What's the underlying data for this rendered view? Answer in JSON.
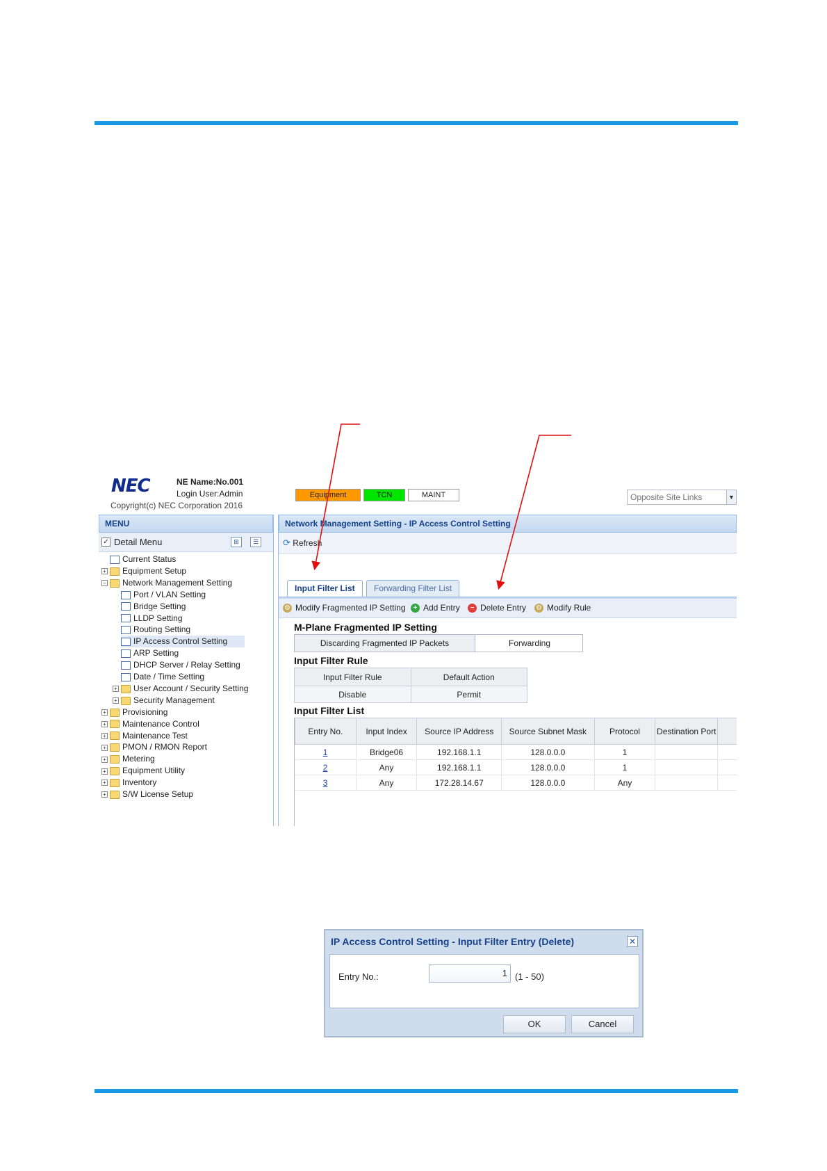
{
  "header": {
    "logo": "NEC",
    "ne_name": "NE Name:No.001",
    "login_user": "Login User:Admin",
    "copyright": "Copyright(c) NEC Corporation 2016",
    "status": [
      {
        "label": "Equipment",
        "color": "#ff9900"
      },
      {
        "label": "TCN",
        "color": "#00e600"
      },
      {
        "label": "MAINT",
        "color": "#ffffff"
      }
    ],
    "opposite_site_links": "Opposite Site Links"
  },
  "menu": {
    "title": "MENU",
    "detail_menu": "Detail Menu",
    "items": [
      {
        "label": "Current Status"
      },
      {
        "label": "Equipment Setup"
      },
      {
        "label": "Network Management Setting"
      },
      {
        "label": "Port / VLAN Setting"
      },
      {
        "label": "Bridge Setting"
      },
      {
        "label": "LLDP Setting"
      },
      {
        "label": "Routing Setting"
      },
      {
        "label": "IP Access Control Setting"
      },
      {
        "label": "ARP Setting"
      },
      {
        "label": "DHCP Server / Relay Setting"
      },
      {
        "label": "Date / Time Setting"
      },
      {
        "label": "User Account / Security Setting"
      },
      {
        "label": "Security Management"
      },
      {
        "label": "Provisioning"
      },
      {
        "label": "Maintenance Control"
      },
      {
        "label": "Maintenance Test"
      },
      {
        "label": "PMON / RMON Report"
      },
      {
        "label": "Metering"
      },
      {
        "label": "Equipment Utility"
      },
      {
        "label": "Inventory"
      },
      {
        "label": "S/W License Setup"
      }
    ]
  },
  "main": {
    "title": "Network Management Setting - IP Access Control Setting",
    "refresh": "Refresh",
    "tabs": [
      {
        "label": "Input Filter List"
      },
      {
        "label": "Forwarding Filter List"
      }
    ],
    "actions": [
      {
        "label": "Modify Fragmented IP Setting"
      },
      {
        "label": "Add Entry"
      },
      {
        "label": "Delete Entry"
      },
      {
        "label": "Modify Rule"
      }
    ],
    "fragment_section": {
      "title": "M-Plane Fragmented IP Setting",
      "key": "Discarding Fragmented IP Packets",
      "value": "Forwarding"
    },
    "rule_section": {
      "title": "Input Filter Rule",
      "headers": [
        "Input Filter Rule",
        "Default Action"
      ],
      "values": [
        "Disable",
        "Permit"
      ]
    },
    "list_section": {
      "title": "Input Filter List",
      "headers": [
        "Entry No.",
        "Input Index",
        "Source IP Address",
        "Source Subnet Mask",
        "Protocol",
        "Destination Port"
      ],
      "rows": [
        [
          "1",
          "Bridge06",
          "192.168.1.1",
          "128.0.0.0",
          "1",
          ""
        ],
        [
          "2",
          "Any",
          "192.168.1.1",
          "128.0.0.0",
          "1",
          ""
        ],
        [
          "3",
          "Any",
          "172.28.14.67",
          "128.0.0.0",
          "Any",
          ""
        ]
      ]
    }
  },
  "dialog": {
    "title": "IP Access Control Setting - Input Filter Entry (Delete)",
    "entry_label": "Entry No.:",
    "entry_value": "1",
    "range": "(1 - 50)",
    "ok": "OK",
    "cancel": "Cancel"
  },
  "colors": {
    "rule": "#1a9ae6",
    "arrow": "#e01010",
    "panel_header": "#c3d8f0"
  }
}
